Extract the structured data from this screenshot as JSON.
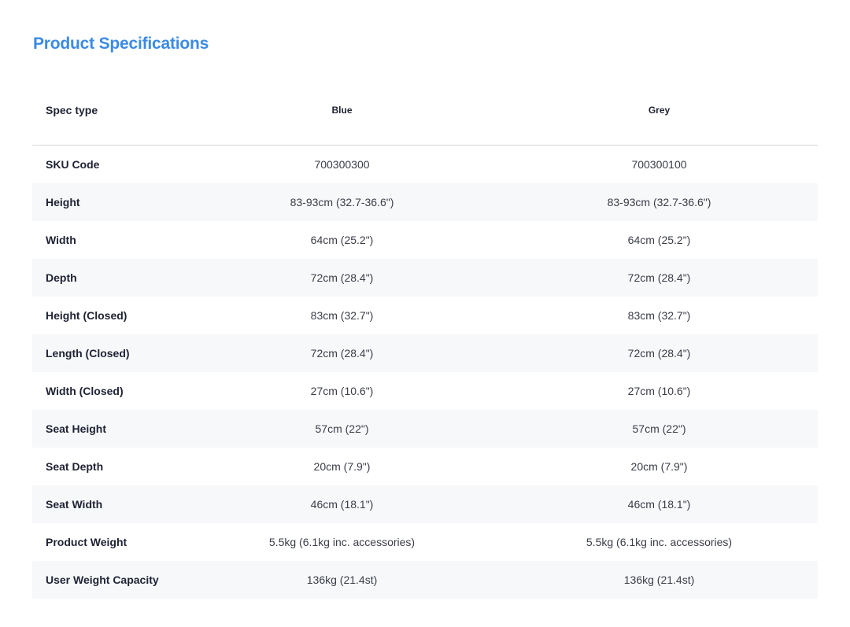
{
  "page": {
    "title": "Product Specifications",
    "accent_color": "#3b8ae6"
  },
  "table": {
    "headers": [
      "Spec type",
      "Blue",
      "Grey"
    ],
    "rows": [
      {
        "label": "SKU Code",
        "blue": "700300300",
        "grey": "700300100"
      },
      {
        "label": "Height",
        "blue": "83-93cm (32.7-36.6\")",
        "grey": "83-93cm (32.7-36.6\")"
      },
      {
        "label": "Width",
        "blue": "64cm (25.2\")",
        "grey": "64cm (25.2\")"
      },
      {
        "label": "Depth",
        "blue": "72cm (28.4\")",
        "grey": "72cm (28.4\")"
      },
      {
        "label": "Height (Closed)",
        "blue": "83cm (32.7\")",
        "grey": "83cm (32.7\")"
      },
      {
        "label": "Length (Closed)",
        "blue": "72cm (28.4\")",
        "grey": "72cm (28.4\")"
      },
      {
        "label": "Width (Closed)",
        "blue": "27cm (10.6\")",
        "grey": "27cm (10.6\")"
      },
      {
        "label": "Seat Height",
        "blue": "57cm (22\")",
        "grey": "57cm (22\")"
      },
      {
        "label": "Seat Depth",
        "blue": "20cm (7.9\")",
        "grey": "20cm (7.9\")"
      },
      {
        "label": "Seat Width",
        "blue": "46cm (18.1\")",
        "grey": "46cm (18.1\")"
      },
      {
        "label": "Product Weight",
        "blue": "5.5kg (6.1kg inc. accessories)",
        "grey": "5.5kg (6.1kg inc. accessories)"
      },
      {
        "label": "User Weight Capacity",
        "blue": "136kg (21.4st)",
        "grey": "136kg (21.4st)"
      }
    ]
  }
}
